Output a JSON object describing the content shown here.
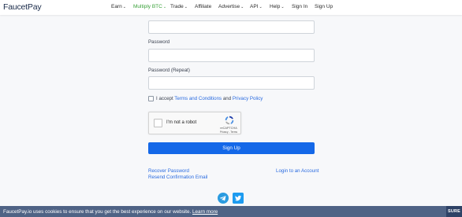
{
  "brand": "FaucetPay",
  "nav": {
    "items": [
      {
        "label": "Earn",
        "dropdown": true
      },
      {
        "label": "Multiply BTC",
        "dropdown": true
      },
      {
        "label": "Trade",
        "dropdown": true
      },
      {
        "label": "Affiliate",
        "dropdown": false
      },
      {
        "label": "Advertise",
        "dropdown": true
      },
      {
        "label": "API",
        "dropdown": true
      },
      {
        "label": "Help",
        "dropdown": true
      },
      {
        "label": "Sign In",
        "dropdown": false
      },
      {
        "label": "Sign Up",
        "dropdown": false
      }
    ],
    "caret": "⌄"
  },
  "form": {
    "password_label": "Password",
    "password_repeat_label": "Password (Repeat)",
    "terms": {
      "prefix": "I accept ",
      "terms_link": "Terms and Conditions",
      "and": " and ",
      "privacy_link": "Privacy Policy"
    },
    "captcha": {
      "label": "I'm not a robot",
      "brand": "reCAPTCHA",
      "terms": "Privacy - Terms"
    },
    "signup_button": "Sign Up",
    "recover_password": "Recover Password",
    "resend_confirmation": "Resend Confirmation Email",
    "login_link": "Login to an Account"
  },
  "social": [
    "telegram-icon",
    "twitter-icon"
  ],
  "cookie": {
    "text": "FaucetPay.io uses cookies to ensure that you get the best experience on our website. ",
    "learn_more": "Learn more",
    "button": "SURE"
  },
  "colors": {
    "accent": "#1468e8",
    "link": "#2a6be0",
    "multiply": "#3aa13a",
    "cookie_bar": "#4f6385"
  }
}
